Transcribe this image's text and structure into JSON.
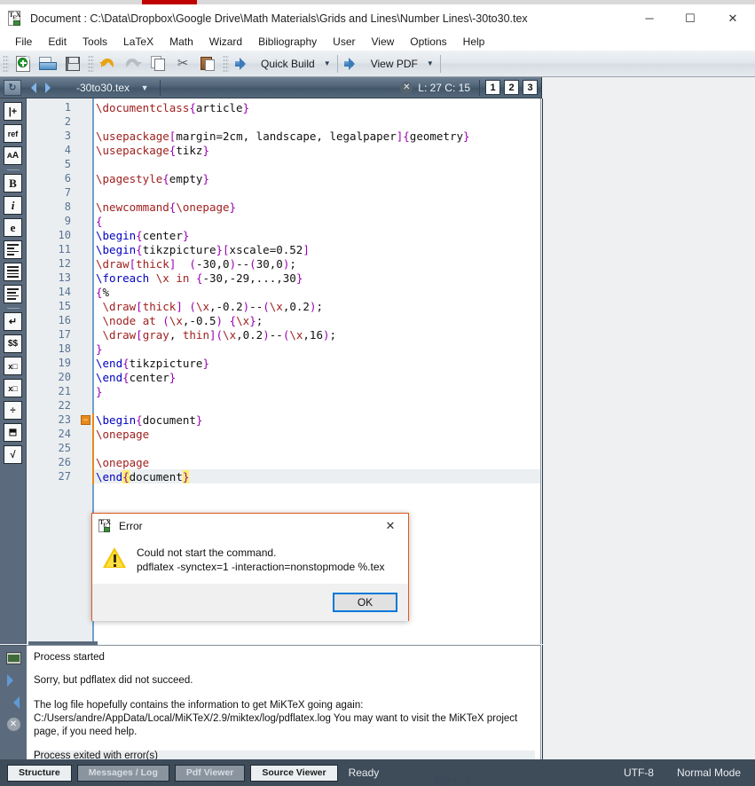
{
  "window": {
    "title": "Document : C:\\Data\\Dropbox\\Google Drive\\Math Materials\\Grids and Lines\\Number Lines\\-30to30.tex",
    "minimize": "─",
    "maximize": "☐",
    "close": "✕",
    "app_icon": "tex-icon"
  },
  "menu": {
    "items": [
      {
        "label": "File"
      },
      {
        "label": "Edit"
      },
      {
        "label": "Tools"
      },
      {
        "label": "LaTeX"
      },
      {
        "label": "Math"
      },
      {
        "label": "Wizard"
      },
      {
        "label": "Bibliography"
      },
      {
        "label": "User"
      },
      {
        "label": "View"
      },
      {
        "label": "Options"
      },
      {
        "label": "Help"
      }
    ]
  },
  "toolbar": {
    "new_icon": "new-document-icon",
    "open_icon": "open-folder-icon",
    "save_icon": "save-floppy-icon",
    "undo_icon": "undo-arrow-icon",
    "redo_icon": "redo-arrow-icon",
    "copy_icon": "copy-icon",
    "cut_icon": "scissors-icon",
    "paste_icon": "paste-icon",
    "build_arrow_icon": "blue-arrow-icon",
    "quick_build_label": "Quick Build",
    "view_pdf_arrow_icon": "blue-arrow-icon",
    "view_pdf_label": "View PDF",
    "dropdown_caret": "▼",
    "cut_glyph": "✂"
  },
  "tabstrip": {
    "refresh_icon": "refresh-icon",
    "refresh_glyph": "↻",
    "prev_icon": "previous-arrow-icon",
    "next_icon": "next-arrow-icon",
    "filename": "-30to30.tex",
    "dropdown_caret": "▼",
    "close_icon": "close-icon",
    "close_glyph": "✕",
    "cursor_position": "L: 27 C: 15",
    "view_buttons": [
      "1",
      "2",
      "3"
    ]
  },
  "left_toolbar": {
    "items": [
      {
        "name": "insert-item",
        "label": "|+"
      },
      {
        "name": "insert-reference",
        "label": "ref"
      },
      {
        "name": "font-size",
        "label": "ᴀA"
      },
      {
        "name": "separator",
        "label": ""
      },
      {
        "name": "bold",
        "label": "B"
      },
      {
        "name": "italic",
        "label": "i"
      },
      {
        "name": "emphasis",
        "label": "e"
      },
      {
        "name": "align-left",
        "label": "lines"
      },
      {
        "name": "align-center",
        "label": "lines"
      },
      {
        "name": "align-justify",
        "label": "lines"
      },
      {
        "name": "separator",
        "label": ""
      },
      {
        "name": "newline",
        "label": "↵"
      },
      {
        "name": "display-math",
        "label": "$$"
      },
      {
        "name": "subscript",
        "label": "x□"
      },
      {
        "name": "superscript",
        "label": "x□"
      },
      {
        "name": "fraction-inline",
        "label": "÷"
      },
      {
        "name": "fraction",
        "label": "⬒"
      },
      {
        "name": "square-root",
        "label": "√"
      }
    ]
  },
  "editor": {
    "current_line": 27,
    "fold_marker_line": 23,
    "fold_marker_glyph": "−",
    "lines": [
      {
        "n": 1,
        "text": "\\documentclass{article}"
      },
      {
        "n": 2,
        "text": ""
      },
      {
        "n": 3,
        "text": "\\usepackage[margin=2cm, landscape, legalpaper]{geometry}"
      },
      {
        "n": 4,
        "text": "\\usepackage{tikz}"
      },
      {
        "n": 5,
        "text": ""
      },
      {
        "n": 6,
        "text": "\\pagestyle{empty}"
      },
      {
        "n": 7,
        "text": ""
      },
      {
        "n": 8,
        "text": "\\newcommand{\\onepage}"
      },
      {
        "n": 9,
        "text": "{"
      },
      {
        "n": 10,
        "text": "\\begin{center}"
      },
      {
        "n": 11,
        "text": "\\begin{tikzpicture}[xscale=0.52]"
      },
      {
        "n": 12,
        "text": "\\draw[thick]  (-30,0)--(30,0);"
      },
      {
        "n": 13,
        "text": "\\foreach \\x in {-30,-29,...,30}"
      },
      {
        "n": 14,
        "text": "{%"
      },
      {
        "n": 15,
        "text": " \\draw[thick] (\\x,-0.2)--(\\x,0.2);"
      },
      {
        "n": 16,
        "text": " \\node at (\\x,-0.5) {\\x};"
      },
      {
        "n": 17,
        "text": " \\draw[gray, thin](\\x,0.2)--(\\x,16);"
      },
      {
        "n": 18,
        "text": "}"
      },
      {
        "n": 19,
        "text": "\\end{tikzpicture}"
      },
      {
        "n": 20,
        "text": "\\end{center}"
      },
      {
        "n": 21,
        "text": "}"
      },
      {
        "n": 22,
        "text": ""
      },
      {
        "n": 23,
        "text": "\\begin{document}"
      },
      {
        "n": 24,
        "text": "\\onepage"
      },
      {
        "n": 25,
        "text": ""
      },
      {
        "n": 26,
        "text": "\\onepage"
      },
      {
        "n": 27,
        "text": "\\end{document}"
      }
    ]
  },
  "dialog": {
    "icon": "tex-icon",
    "title": "Error",
    "close_glyph": "✕",
    "warning_icon": "warning-triangle-icon",
    "message_line1": "Could not start the command.",
    "message_line2": "pdflatex -synctex=1 -interaction=nonstopmode %.tex",
    "ok_label": "OK"
  },
  "log_panel": {
    "icons": [
      {
        "name": "output-monitor-icon"
      },
      {
        "name": "next-error-icon"
      },
      {
        "name": "previous-error-icon"
      },
      {
        "name": "stop-process-icon"
      }
    ],
    "lines": [
      "Process started",
      "Sorry, but pdflatex did not succeed.",
      "The log file hopefully contains the information to get MiKTeX going again: C:/Users/andre/AppData/Local/MiKTeX/2.9/miktex/log/pdflatex.log You may want to visit the MiKTeX project page, if you need help.",
      "Process exited with error(s)"
    ]
  },
  "status_bar": {
    "tabs": [
      {
        "label": "Structure",
        "active": true
      },
      {
        "label": "Messages / Log",
        "active": false
      },
      {
        "label": "Pdf Viewer",
        "active": false
      },
      {
        "label": "Source Viewer",
        "active": true
      }
    ],
    "state": "Ready",
    "encoding": "UTF-8",
    "mode": "Normal Mode"
  },
  "colors": {
    "chrome_slate": "#5b6b7d",
    "tabstrip_blue": "#4f6478",
    "accent_orange": "#e8891a",
    "error_border": "#e05a1a",
    "focus_blue": "#0078d7",
    "keyword_blue": "#0000c0",
    "keyword_red": "#a02020",
    "brace_purple": "#9b00b4",
    "option_orange": "#b07000",
    "brace_highlight": "#fff066",
    "spell_error": "#d00000",
    "statusbar_dark": "#3e4b59"
  }
}
